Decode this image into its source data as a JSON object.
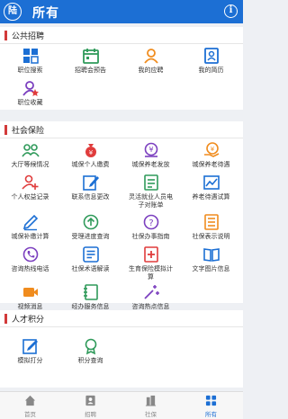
{
  "header": {
    "logo": "陆",
    "title": "所有",
    "info_icon": "info-icon"
  },
  "colors": {
    "primary": "#1c6fd4",
    "accent": "#d23a3a",
    "orange": "#f08c1e",
    "purple": "#7b3fbf",
    "green": "#2f9a5a",
    "red": "#e03c3c"
  },
  "sections": [
    {
      "title": "公共招聘",
      "items": [
        "职位搜索",
        "招聘会预告",
        "我的应聘",
        "我的简历",
        "职位收藏"
      ]
    },
    {
      "title": "社会保险",
      "items": [
        "大厅等候情况",
        "城保个人缴费",
        "城保养老发放",
        "城保养老待遇",
        "个人权益记录",
        "联系信息更改",
        "灵活就业人员电子对账单",
        "养老待遇试算",
        "城保补缴计算",
        "受理进度查询",
        "社保办事指南",
        "社保表示说明",
        "咨询热线电话",
        "社保术语解读",
        "生育保险模拟计算",
        "文字图片信息",
        "视频消息",
        "经办服务信息",
        "咨询热点信息"
      ]
    },
    {
      "title": "人才积分",
      "items": [
        "模拟打分",
        "积分查询"
      ]
    }
  ],
  "tabs": [
    {
      "label": "首页",
      "active": false
    },
    {
      "label": "招聘",
      "active": false
    },
    {
      "label": "社保",
      "active": false
    },
    {
      "label": "所有",
      "active": true
    }
  ]
}
